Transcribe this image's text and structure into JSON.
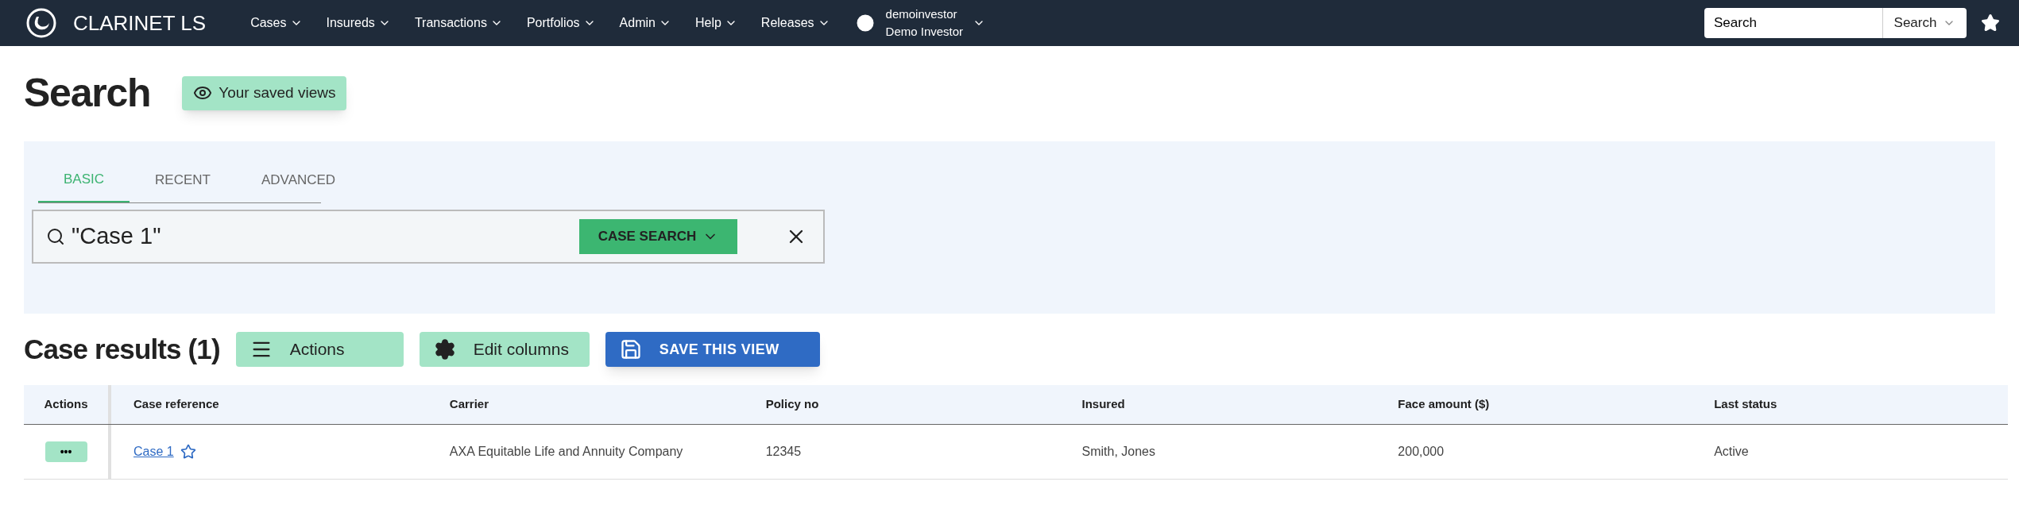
{
  "app": {
    "name": "CLARINET LS"
  },
  "nav": [
    {
      "label": "Cases"
    },
    {
      "label": "Insureds"
    },
    {
      "label": "Transactions"
    },
    {
      "label": "Portfolios"
    },
    {
      "label": "Admin"
    },
    {
      "label": "Help"
    },
    {
      "label": "Releases"
    }
  ],
  "user": {
    "username": "demoinvestor",
    "display_name": "Demo Investor"
  },
  "global_search": {
    "value": "Search",
    "scope": "Search"
  },
  "page": {
    "title": "Search",
    "saved_views_button": "Your saved views"
  },
  "tabs": [
    {
      "label": "BASIC",
      "selected": true
    },
    {
      "label": "RECENT",
      "selected": false
    },
    {
      "label": "ADVANCED",
      "selected": false
    }
  ],
  "search": {
    "value": "\"Case 1\"",
    "mode_button": "CASE SEARCH"
  },
  "results": {
    "title": "Case results (1)",
    "buttons": [
      {
        "kind": "actions",
        "label": "Actions"
      },
      {
        "kind": "edit_columns",
        "label": "Edit columns"
      },
      {
        "kind": "save",
        "label": "SAVE THIS VIEW"
      }
    ]
  },
  "table": {
    "columns": [
      "Actions",
      "Case reference",
      "Carrier",
      "Policy no",
      "Insured",
      "Face amount ($)",
      "Last status"
    ],
    "rows": [
      {
        "starred": false,
        "cells": [
          "•••",
          "Case 1",
          "AXA Equitable Life and Annuity Company",
          "12345",
          "Smith, Jones",
          "200,000",
          "Active"
        ]
      }
    ]
  }
}
